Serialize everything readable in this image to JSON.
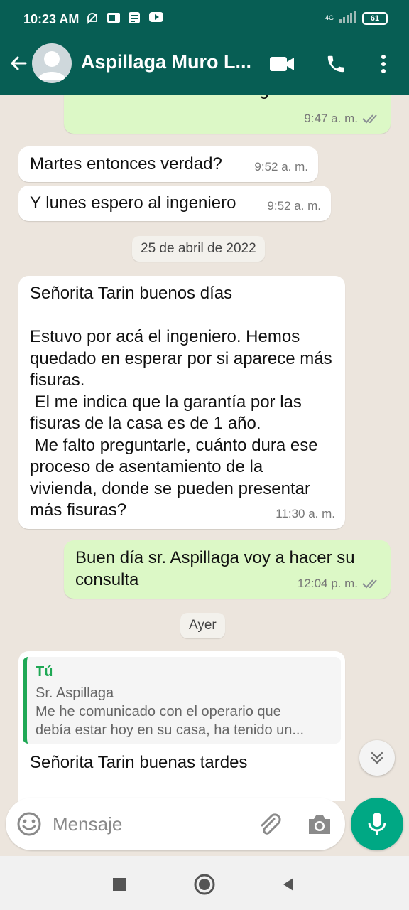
{
  "status_bar": {
    "time": "10:23 AM",
    "network": "4G",
    "battery": "61"
  },
  "header": {
    "contact_name": "Aspillaga Muro L...",
    "icons": [
      "back-arrow-icon",
      "avatar",
      "video-call-icon",
      "phone-icon",
      "more-options-icon"
    ]
  },
  "messages": [
    {
      "direction": "out",
      "text": "mantiene la visita del ingeniero.",
      "time": "9:47 a. m.",
      "status": "read"
    },
    {
      "direction": "in",
      "text": "Martes entonces verdad?",
      "time": "9:52 a. m."
    },
    {
      "direction": "in",
      "text": "Y lunes espero al ingeniero",
      "time": "9:52 a. m."
    },
    {
      "direction": "in",
      "text": "Señorita Tarin buenos días\n\nEstuvo por acá el ingeniero. Hemos quedado en esperar por si aparece más fisuras.\n El me indica que la garantía por las fisuras de la casa es de 1 año.\n Me falto preguntarle, cuánto dura ese proceso de asentamiento de la vivienda, donde se pueden presentar más fisuras?",
      "time": "11:30 a. m."
    },
    {
      "direction": "out",
      "text": "Buen día sr. Aspillaga voy a hacer su consulta",
      "time": "12:04 p. m.",
      "status": "read"
    },
    {
      "direction": "in",
      "reply_author": "Tú",
      "reply_line1": "Sr. Aspillaga",
      "reply_line2": "Me he comunicado con el operario que",
      "reply_line3": "debía estar hoy en su casa, ha tenido un...",
      "text": "Señorita Tarin buenas tardes"
    }
  ],
  "date_separators": [
    "25 de abril de 2022",
    "Ayer"
  ],
  "composer": {
    "placeholder": "Mensaje"
  },
  "colors": {
    "header": "#075e54",
    "chat_background": "#ece5dd",
    "outgoing_bubble": "#dcf8c6",
    "incoming_bubble": "#ffffff",
    "mic_button": "#00a884",
    "read_ticks": "#8a8f94"
  }
}
